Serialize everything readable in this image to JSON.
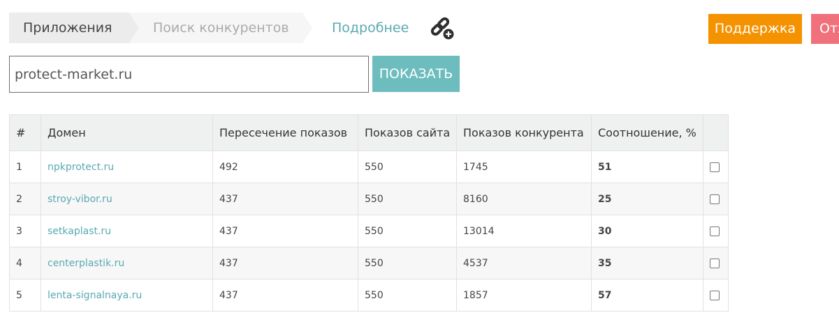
{
  "breadcrumb": {
    "items": [
      {
        "label": "Приложения"
      },
      {
        "label": "Поиск конкурентов"
      }
    ]
  },
  "header": {
    "more_label": "Подробнее",
    "link_icon": "link-add-icon",
    "support_label": "Поддержка",
    "feedback_label": "Отз"
  },
  "search": {
    "value": "protect-market.ru",
    "button_label": "ПОКАЗАТЬ"
  },
  "table": {
    "columns": [
      "#",
      "Домен",
      "Пересечение показов",
      "Показов сайта",
      "Показов конкурента",
      "Соотношение, %",
      ""
    ],
    "rows": [
      {
        "num": "1",
        "domain": "npkprotect.ru",
        "overlap": "492",
        "site_shows": "550",
        "competitor_shows": "1745",
        "ratio": "51"
      },
      {
        "num": "2",
        "domain": "stroy-vibor.ru",
        "overlap": "437",
        "site_shows": "550",
        "competitor_shows": "8160",
        "ratio": "25"
      },
      {
        "num": "3",
        "domain": "setkaplast.ru",
        "overlap": "437",
        "site_shows": "550",
        "competitor_shows": "13014",
        "ratio": "30"
      },
      {
        "num": "4",
        "domain": "centerplastik.ru",
        "overlap": "437",
        "site_shows": "550",
        "competitor_shows": "4537",
        "ratio": "35"
      },
      {
        "num": "5",
        "domain": "lenta-signalnaya.ru",
        "overlap": "437",
        "site_shows": "550",
        "competitor_shows": "1857",
        "ratio": "57"
      }
    ]
  },
  "colors": {
    "accent_teal": "#6dbdbf",
    "link_teal": "#5aa9b1",
    "support_orange": "#f49200",
    "feedback_red": "#f0707b"
  }
}
